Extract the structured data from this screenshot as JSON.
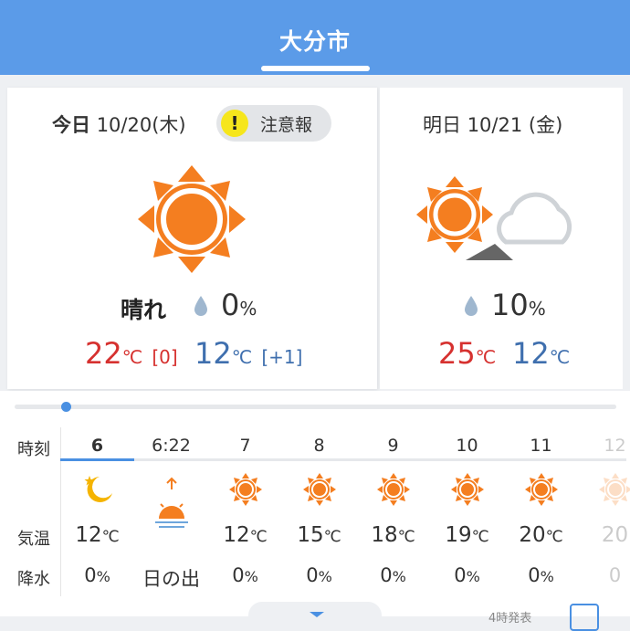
{
  "header": {
    "title": "大分市"
  },
  "today": {
    "label": "今日",
    "date": "10/20",
    "dow": "(木)",
    "warning_icon": "exclamation-icon",
    "warning_mark": "!",
    "warning_label": "注意報",
    "weather_icon": "sun-icon",
    "condition": "晴れ",
    "rain_icon": "raindrop-icon",
    "precip_value": "0",
    "precip_unit": "%",
    "high": "22",
    "high_unit": "℃",
    "high_diff": "[0]",
    "low": "12",
    "low_unit": "℃",
    "low_diff": "[+1]"
  },
  "tomorrow": {
    "label": "明日",
    "date": "10/21",
    "dow": "(金)",
    "weather_icon": "sun-then-cloud-icon",
    "rain_icon": "raindrop-icon",
    "precip_value": "10",
    "precip_unit": "%",
    "high": "25",
    "high_unit": "℃",
    "low": "12",
    "low_unit": "℃"
  },
  "hourly": {
    "labels": {
      "time": "時刻",
      "temp": "気温",
      "precip": "降水"
    },
    "columns": [
      {
        "time": "6",
        "icon": "moon-icon",
        "temp": "12",
        "unit": "℃",
        "rain": "0",
        "rain_unit": "%"
      },
      {
        "time": "6:22",
        "icon": "sunrise-icon",
        "temp": "",
        "unit": "",
        "rain": "日の出",
        "rain_unit": ""
      },
      {
        "time": "7",
        "icon": "sun-icon",
        "temp": "12",
        "unit": "℃",
        "rain": "0",
        "rain_unit": "%"
      },
      {
        "time": "8",
        "icon": "sun-icon",
        "temp": "15",
        "unit": "℃",
        "rain": "0",
        "rain_unit": "%"
      },
      {
        "time": "9",
        "icon": "sun-icon",
        "temp": "18",
        "unit": "℃",
        "rain": "0",
        "rain_unit": "%"
      },
      {
        "time": "10",
        "icon": "sun-icon",
        "temp": "19",
        "unit": "℃",
        "rain": "0",
        "rain_unit": "%"
      },
      {
        "time": "11",
        "icon": "sun-icon",
        "temp": "20",
        "unit": "℃",
        "rain": "0",
        "rain_unit": "%"
      },
      {
        "time": "12",
        "icon": "sun-icon",
        "temp": "20",
        "unit": "",
        "rain": "0",
        "rain_unit": ""
      }
    ]
  },
  "footer": {
    "note": "4時発表"
  },
  "colors": {
    "header": "#5b9be8",
    "sun": "#f47e20",
    "high": "#d6312f",
    "low": "#3f6fae",
    "warning": "#f6e61c",
    "accent": "#4a90e2"
  }
}
